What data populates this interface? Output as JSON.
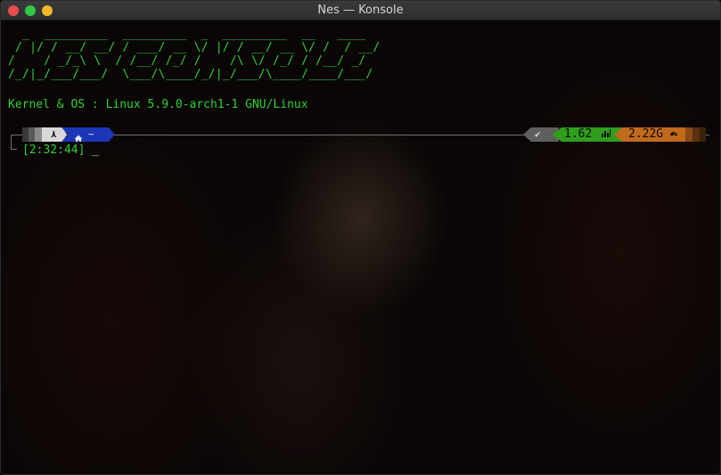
{
  "window": {
    "title": "Nes — Konsole"
  },
  "terminal": {
    "ascii_banner": "  _  _________  _________  _  _________  __   ____\n / |/ / __/ __/ / ___/ __ \\/ |/ / __/ __ \\/ /  / __/\n/    / _/_\\ \\  / /__/ /_/ /    /\\ \\/ /_/ / /__/ _/\n/_/|_/___/___/  \\___/\\____/_/|_/___/\\____/____/___/",
    "kernel_label": "Kernel & OS",
    "kernel_sep": " : ",
    "kernel_value": "Linux 5.9.0-arch1-1 GNU/Linux",
    "prompt": {
      "os_icon": "⋏",
      "dir_icon": "home-icon",
      "dir_text": "~",
      "status_icon": "✔",
      "load": "1.62",
      "load_icon": "bar-chart-icon",
      "memory": "2.22G",
      "memory_icon": "gauge-icon",
      "time": "[2:32:44]",
      "cursor": "_"
    }
  },
  "colors": {
    "green": "#2fd12f",
    "dir_segment": "#1d36b8",
    "load_segment": "#2f9e1c",
    "memory_segment": "#c26a1c"
  }
}
